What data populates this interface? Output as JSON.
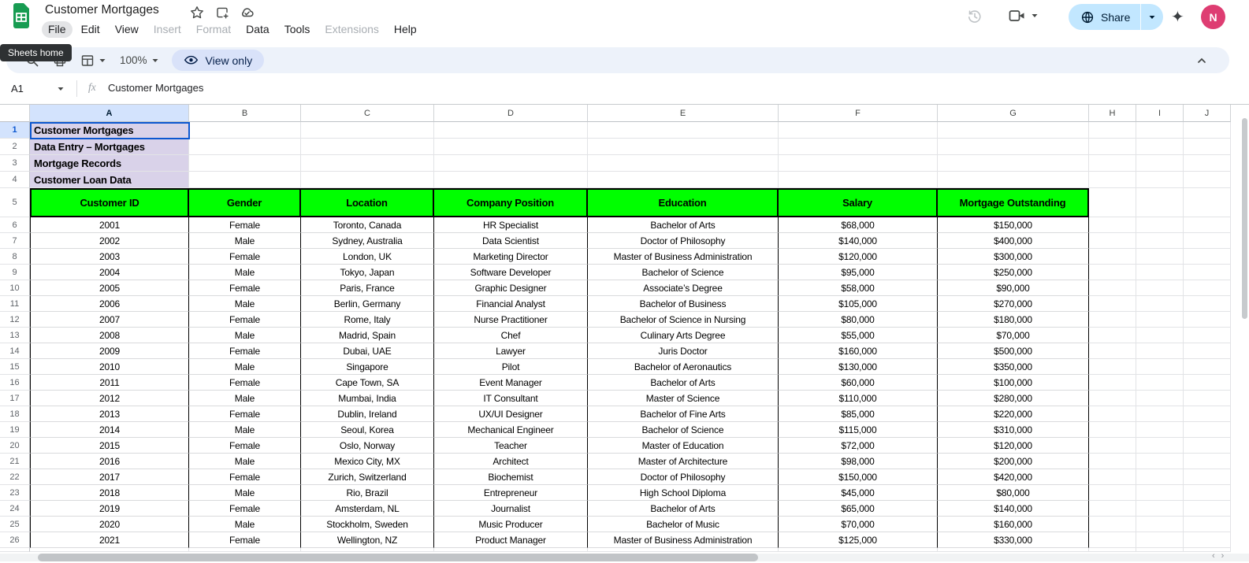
{
  "app": {
    "title": "Customer Mortgages"
  },
  "menu": {
    "items": [
      {
        "label": "File",
        "state": "active"
      },
      {
        "label": "Edit"
      },
      {
        "label": "View"
      },
      {
        "label": "Insert",
        "state": "disabled"
      },
      {
        "label": "Format",
        "state": "disabled"
      },
      {
        "label": "Data"
      },
      {
        "label": "Tools"
      },
      {
        "label": "Extensions",
        "state": "disabled"
      },
      {
        "label": "Help"
      }
    ]
  },
  "topbar_right": {
    "share_label": "Share",
    "avatar_initial": "N"
  },
  "toolbar": {
    "tooltip": "Sheets home",
    "zoom_level": "100%",
    "view_only_label": "View only"
  },
  "formula_bar": {
    "cell_ref": "A1",
    "value": "Customer Mortgages"
  },
  "grid": {
    "column_letters": [
      "A",
      "B",
      "C",
      "D",
      "E",
      "F",
      "G",
      "H",
      "I",
      "J"
    ],
    "selected_column": "A",
    "selected_row": 1,
    "row_numbers": [
      1,
      2,
      3,
      4,
      5,
      6,
      7,
      8,
      9,
      10,
      11,
      12,
      13,
      14,
      15,
      16,
      17,
      18,
      19,
      20,
      21,
      22,
      23,
      24,
      25,
      26
    ],
    "title_cells": [
      "Customer Mortgages",
      "Data Entry – Mortgages",
      "Mortgage Records",
      "Customer Loan Data"
    ],
    "table": {
      "headers": [
        "Customer ID",
        "Gender",
        "Location",
        "Company Position",
        "Education",
        "Salary",
        "Mortgage Outstanding"
      ],
      "rows": [
        [
          "2001",
          "Female",
          "Toronto, Canada",
          "HR Specialist",
          "Bachelor of Arts",
          "$68,000",
          "$150,000"
        ],
        [
          "2002",
          "Male",
          "Sydney, Australia",
          "Data Scientist",
          "Doctor of Philosophy",
          "$140,000",
          "$400,000"
        ],
        [
          "2003",
          "Female",
          "London, UK",
          "Marketing Director",
          "Master of Business Administration",
          "$120,000",
          "$300,000"
        ],
        [
          "2004",
          "Male",
          "Tokyo, Japan",
          "Software Developer",
          "Bachelor of Science",
          "$95,000",
          "$250,000"
        ],
        [
          "2005",
          "Female",
          "Paris, France",
          "Graphic Designer",
          "Associate’s Degree",
          "$58,000",
          "$90,000"
        ],
        [
          "2006",
          "Male",
          "Berlin, Germany",
          "Financial Analyst",
          "Bachelor of Business",
          "$105,000",
          "$270,000"
        ],
        [
          "2007",
          "Female",
          "Rome, Italy",
          "Nurse Practitioner",
          "Bachelor of Science in Nursing",
          "$80,000",
          "$180,000"
        ],
        [
          "2008",
          "Male",
          "Madrid, Spain",
          "Chef",
          "Culinary Arts Degree",
          "$55,000",
          "$70,000"
        ],
        [
          "2009",
          "Female",
          "Dubai, UAE",
          "Lawyer",
          "Juris Doctor",
          "$160,000",
          "$500,000"
        ],
        [
          "2010",
          "Male",
          "Singapore",
          "Pilot",
          "Bachelor of Aeronautics",
          "$130,000",
          "$350,000"
        ],
        [
          "2011",
          "Female",
          "Cape Town, SA",
          "Event Manager",
          "Bachelor of Arts",
          "$60,000",
          "$100,000"
        ],
        [
          "2012",
          "Male",
          "Mumbai, India",
          "IT Consultant",
          "Master of Science",
          "$110,000",
          "$280,000"
        ],
        [
          "2013",
          "Female",
          "Dublin, Ireland",
          "UX/UI Designer",
          "Bachelor of Fine Arts",
          "$85,000",
          "$220,000"
        ],
        [
          "2014",
          "Male",
          "Seoul, Korea",
          "Mechanical Engineer",
          "Bachelor of Science",
          "$115,000",
          "$310,000"
        ],
        [
          "2015",
          "Female",
          "Oslo, Norway",
          "Teacher",
          "Master of Education",
          "$72,000",
          "$120,000"
        ],
        [
          "2016",
          "Male",
          "Mexico City, MX",
          "Architect",
          "Master of Architecture",
          "$98,000",
          "$200,000"
        ],
        [
          "2017",
          "Female",
          "Zurich, Switzerland",
          "Biochemist",
          "Doctor of Philosophy",
          "$150,000",
          "$420,000"
        ],
        [
          "2018",
          "Male",
          "Rio, Brazil",
          "Entrepreneur",
          "High School Diploma",
          "$45,000",
          "$80,000"
        ],
        [
          "2019",
          "Female",
          "Amsterdam, NL",
          "Journalist",
          "Bachelor of Arts",
          "$65,000",
          "$140,000"
        ],
        [
          "2020",
          "Male",
          "Stockholm, Sweden",
          "Music Producer",
          "Bachelor of Music",
          "$70,000",
          "$160,000"
        ],
        [
          "2021",
          "Female",
          "Wellington, NZ",
          "Product Manager",
          "Master of Business Administration",
          "$125,000",
          "$330,000"
        ]
      ]
    }
  },
  "colors": {
    "header_green": "#00ff00",
    "title_fill": "#d9d2e9",
    "selection_blue": "#0b57d0",
    "selected_header_fill": "#d3e3fd",
    "share_pill": "#c2e7ff",
    "view_only_pill": "#d9e2f9",
    "avatar_pink": "#de3d72",
    "logo_green": "#189c52"
  }
}
